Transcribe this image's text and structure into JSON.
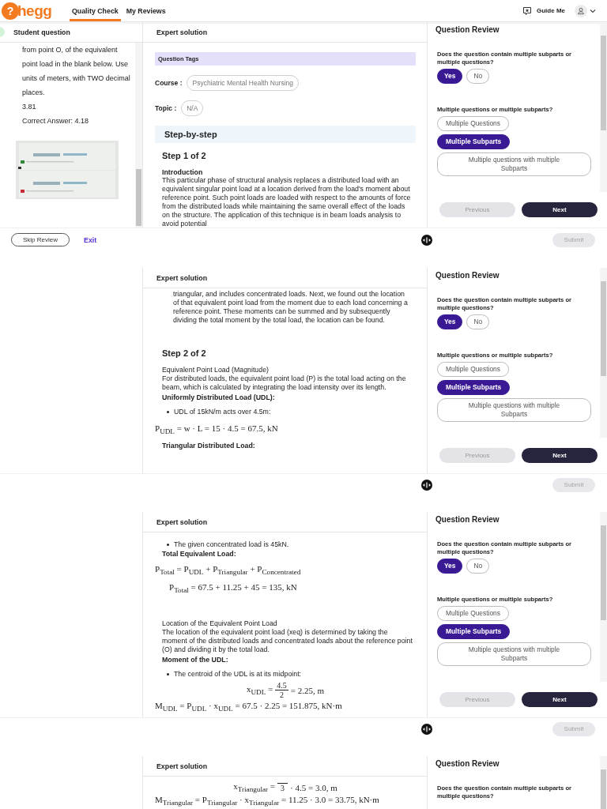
{
  "header": {
    "logo_mark": "?",
    "logo_text": "hegg",
    "nav": [
      {
        "label": "Quality Check",
        "selected": true
      },
      {
        "label": "My Reviews",
        "selected": false
      }
    ],
    "guide_me": "Guide Me"
  },
  "frames": [
    {
      "student": {
        "title": "Student question",
        "paragraph": "from point O, of the equivalent point load in the blank below. Use units of meters, with TWO decimal places.",
        "answer": "3.81",
        "correct_answer": "Correct Answer: 4.18"
      },
      "expert": {
        "title": "Expert solution",
        "blocks": [
          {
            "kind": "tags_bar",
            "text": "Question Tags"
          },
          {
            "kind": "tag",
            "label": "Course :",
            "value": "Psychiatric Mental Health Nursing"
          },
          {
            "kind": "tag",
            "label": "Topic :",
            "value": "N/A"
          },
          {
            "kind": "banner",
            "text": "Step-by-step"
          },
          {
            "kind": "step",
            "text": "Step 1 of 2"
          },
          {
            "kind": "heading",
            "text": "Introduction"
          },
          {
            "kind": "text",
            "text": "This particular phase of structural analysis replaces a distributed load with an equivalent singular point load at a location derived from the load's moment about reference point. Such point loads are loaded with respect to the amounts of force from the distributed loads while maintaining the same overall effect of the loads on the structure. The application of this technique is in beam loads analysis to avoid potential"
          }
        ]
      },
      "review": {
        "title": "Question Review",
        "questions": [
          {
            "kind": "yes_no",
            "text": "Does the question contain multiple subparts or multiple questions?",
            "options": [
              {
                "label": "Yes",
                "selected": true
              },
              {
                "label": "No",
                "selected": false
              }
            ]
          },
          {
            "kind": "choice",
            "text": "Multiple questions or multiple subparts?",
            "options": [
              {
                "label": "Multiple Questions",
                "selected": false
              },
              {
                "label": "Multiple Subparts",
                "selected": true
              },
              {
                "label": "Multiple questions with multiple Subparts",
                "selected": false
              }
            ]
          }
        ],
        "nav": [
          {
            "label": "Previous",
            "disabled": true
          },
          {
            "label": "Next",
            "disabled": false
          }
        ]
      },
      "footer": {
        "skip": "Skip Review",
        "exit": "Exit",
        "submit": {
          "label": "Submit",
          "disabled": true
        }
      }
    },
    {
      "expert": {
        "title": "Expert solution",
        "blocks": [
          {
            "kind": "indented_text",
            "text": "triangular, and includes concentrated loads. Next, we found out the location of that equivalent point load from the moment due to each load concerning a reference point. These moments can be summed and by subsequently dividing the total moment by the total load, the location can be found."
          },
          {
            "kind": "step",
            "text": "Step 2 of 2"
          },
          {
            "kind": "text",
            "text": "Equivalent Point Load (Magnitude)"
          },
          {
            "kind": "text",
            "text": "For distributed loads, the equivalent point load (P) is the total load acting on the beam, which is calculated by integrating the load intensity over its length."
          },
          {
            "kind": "heading",
            "text": "Uniformly Distributed Load (UDL):"
          },
          {
            "kind": "bullet",
            "text": "UDL of 15kN/m acts over 4.5m:"
          },
          {
            "kind": "math",
            "text": "P$_{UDL}$ = w · L = 15 · 4.5 = 67.5, kN"
          },
          {
            "kind": "heading",
            "text": "Triangular Distributed Load:"
          }
        ]
      },
      "review": {
        "title": "Question Review",
        "questions": [
          {
            "kind": "yes_no",
            "text": "Does the question contain multiple subparts or multiple questions?",
            "options": [
              {
                "label": "Yes",
                "selected": true
              },
              {
                "label": "No",
                "selected": false
              }
            ]
          },
          {
            "kind": "choice",
            "text": "Multiple questions or multiple subparts?",
            "options": [
              {
                "label": "Multiple Questions",
                "selected": false
              },
              {
                "label": "Multiple Subparts",
                "selected": true
              },
              {
                "label": "Multiple questions with multiple Subparts",
                "selected": false
              }
            ]
          }
        ],
        "nav": [
          {
            "label": "Previous",
            "disabled": true
          },
          {
            "label": "Next",
            "disabled": false
          }
        ]
      },
      "footer": {
        "submit": {
          "label": "Submit",
          "disabled": true
        }
      }
    },
    {
      "expert": {
        "title": "Expert solution",
        "blocks": [
          {
            "kind": "bullet",
            "text": "The given concentrated load is 45kN."
          },
          {
            "kind": "heading",
            "text": "Total Equivalent Load:"
          },
          {
            "kind": "math",
            "text": "P$_{Total}$ = P$_{UDL}$ + P$_{Triangular}$ + P$_{Concentrated}$"
          },
          {
            "kind": "math_indented",
            "text": "P$_{Total}$ = 67.5 + 11.25 + 45 = 135, kN"
          },
          {
            "kind": "text",
            "text": "Location of the Equivalent Point Load"
          },
          {
            "kind": "text",
            "text": "The location of the equivalent point load (xeq) is determined by taking the moment of the distributed loads and concentrated loads about the reference point (O) and dividing it by the total load."
          },
          {
            "kind": "heading",
            "text": "Moment of the UDL:"
          },
          {
            "kind": "bullet",
            "text": "The centroid of the UDL is at its midpoint:"
          },
          {
            "kind": "fraction",
            "lhs": "x$_{UDL}$ =",
            "num": "4.5",
            "den": "2",
            "rhs": "= 2.25, m"
          },
          {
            "kind": "math",
            "text": "M$_{UDL}$ = P$_{UDL}$ · x$_{UDL}$ = 67.5 · 2.25 = 151.875, kN·m"
          }
        ]
      },
      "review": {
        "title": "Question Review",
        "questions": [
          {
            "kind": "yes_no",
            "text": "Does the question contain multiple subparts or multiple questions?",
            "options": [
              {
                "label": "Yes",
                "selected": true
              },
              {
                "label": "No",
                "selected": false
              }
            ]
          },
          {
            "kind": "choice",
            "text": "Multiple questions or multiple subparts?",
            "options": [
              {
                "label": "Multiple Questions",
                "selected": false
              },
              {
                "label": "Multiple Subparts",
                "selected": true
              },
              {
                "label": "Multiple questions with multiple Subparts",
                "selected": false
              }
            ]
          }
        ],
        "nav": [
          {
            "label": "Previous",
            "disabled": true
          },
          {
            "label": "Next",
            "disabled": false
          }
        ]
      },
      "footer": {
        "submit": {
          "label": "Submit",
          "disabled": true
        }
      }
    },
    {
      "expert": {
        "title": "Expert solution",
        "blocks": [
          {
            "kind": "fraction",
            "lhs": "x$_{Triangular}$ =",
            "den": "3",
            "rhs": "· 4.5 = 3.0, m"
          },
          {
            "kind": "math",
            "text": "M$_{Triangular}$ = P$_{Triangular}$ · x$_{Triangular}$ = 11.25 · 3.0 = 33.75, kN·m"
          }
        ]
      },
      "review": {
        "title": "Question Review",
        "questions": [
          {
            "text": "Does the question contain multiple subparts or multiple questions?"
          }
        ]
      }
    }
  ]
}
